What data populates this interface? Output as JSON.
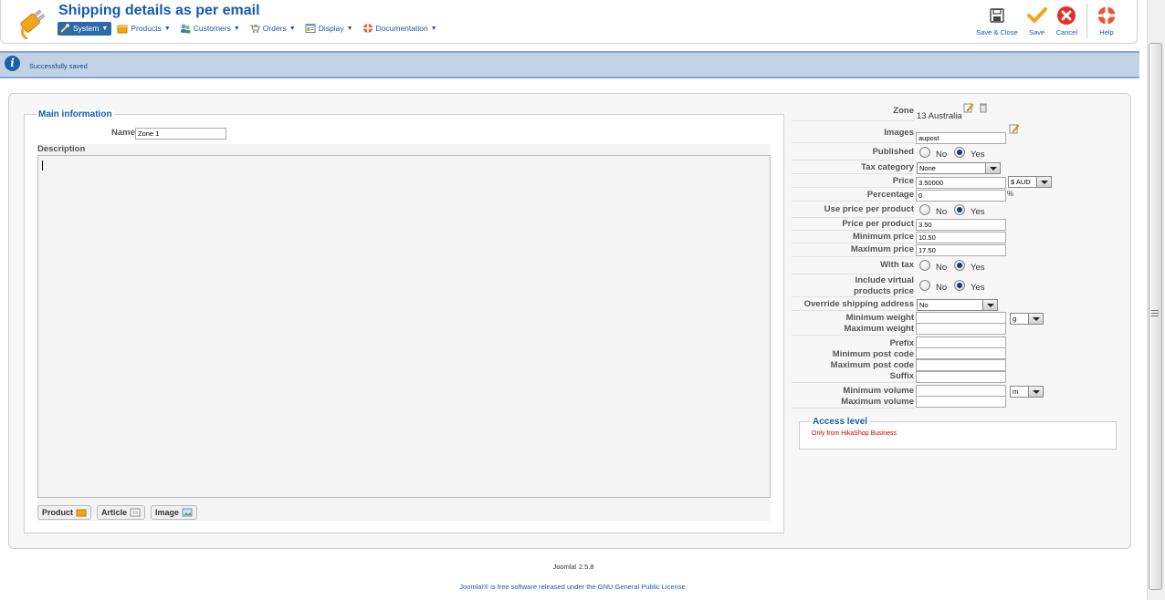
{
  "header": {
    "title": "Shipping details as per email",
    "menu": [
      {
        "label": "System",
        "icon": "tools-icon"
      },
      {
        "label": "Products",
        "icon": "products-icon"
      },
      {
        "label": "Customers",
        "icon": "customers-icon"
      },
      {
        "label": "Orders",
        "icon": "orders-icon"
      },
      {
        "label": "Display",
        "icon": "display-icon"
      },
      {
        "label": "Documentation",
        "icon": "lifebuoy-icon"
      }
    ],
    "toolbar": {
      "save_close": "Save & Close",
      "save": "Save",
      "cancel": "Cancel",
      "help": "Help"
    }
  },
  "message": {
    "text": "Successfully saved"
  },
  "main_info": {
    "legend": "Main information",
    "name_label": "Name",
    "name_value": "Zone 1",
    "description_label": "Description",
    "buttons": {
      "product": "Product",
      "article": "Article",
      "image": "Image"
    }
  },
  "form": {
    "zone_label": "Zone",
    "zone_value": "13 Australia",
    "images_label": "Images",
    "images_value": "aupost",
    "published_label": "Published",
    "no": "No",
    "yes": "Yes",
    "tax_category_label": "Tax category",
    "tax_category_value": "None",
    "price_label": "Price",
    "price_value": "3.50000",
    "currency_value": "$ AUD",
    "percentage_label": "Percentage",
    "percentage_value": "0",
    "percent_sign": "%",
    "use_price_per_product_label": "Use price per product",
    "price_per_product_label": "Price per product",
    "price_per_product_value": "3.50",
    "minimum_price_label": "Minimum price",
    "minimum_price_value": "10.50",
    "maximum_price_label": "Maximum price",
    "maximum_price_value": "17.50",
    "with_tax_label": "With tax",
    "include_virtual_label_1": "Include virtual",
    "include_virtual_label_2": "products price",
    "override_shipping_label": "Override shipping address",
    "override_shipping_value": "No",
    "minimum_weight_label": "Minimum weight",
    "maximum_weight_label": "Maximum weight",
    "weight_unit": "g",
    "prefix_label": "Prefix",
    "minimum_post_code_label": "Minimum post code",
    "maximum_post_code_label": "Maximum post code",
    "suffix_label": "Suffix",
    "minimum_volume_label": "Minimum volume",
    "maximum_volume_label": "Maximum volume",
    "volume_unit": "m"
  },
  "access": {
    "legend": "Access level",
    "text": "Only from HikaShop Business"
  },
  "footer": {
    "version": "Joomla! 2.5.8",
    "license_prefix": "Joomla!® is free software released under the",
    "license_link": "GNU General Public License."
  }
}
